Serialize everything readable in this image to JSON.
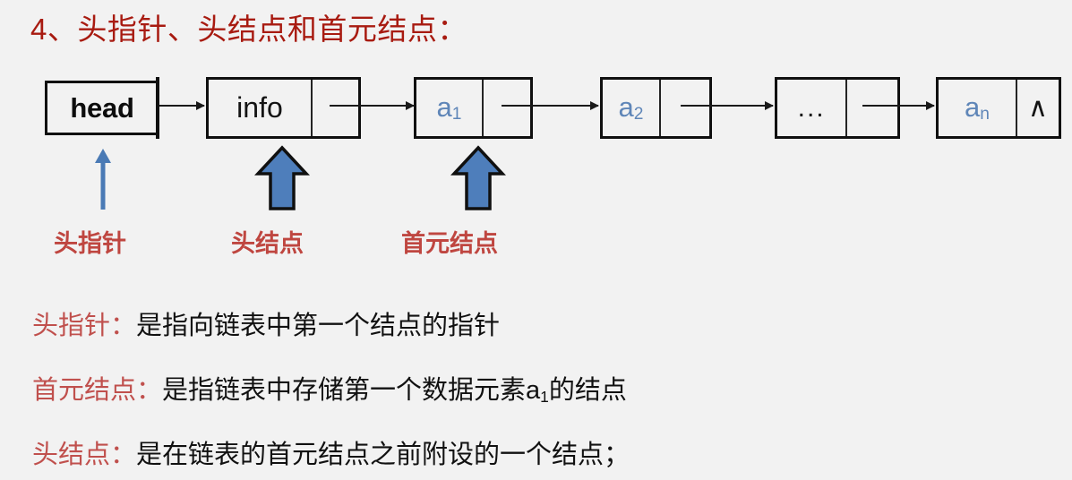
{
  "slide": {
    "title": "4、头指针、头结点和首元结点：",
    "background_color": "#f2f2f2",
    "title_color": "#a81b11"
  },
  "diagram": {
    "head_pointer": {
      "label": "head"
    },
    "nodes": [
      {
        "data": "info",
        "next": "",
        "type": "head-node"
      },
      {
        "data": "a",
        "sub": "1",
        "next": "",
        "type": "first-element-node"
      },
      {
        "data": "a",
        "sub": "2",
        "next": "",
        "type": "node"
      },
      {
        "data": "...",
        "next": "",
        "type": "ellipsis-node"
      },
      {
        "data": "a",
        "sub": "n",
        "next": "∧",
        "type": "tail-node"
      }
    ],
    "callouts": [
      {
        "label": "头指针",
        "arrow": "thin"
      },
      {
        "label": "头结点",
        "arrow": "thick"
      },
      {
        "label": "首元结点",
        "arrow": "thick"
      }
    ],
    "colors": {
      "node_border": "#101010",
      "node_text_blue": "#5f86b8",
      "arrow_blue": "#4a7ab5",
      "callout_red": "#bf4640"
    }
  },
  "definitions": [
    {
      "term": "头指针：",
      "body": "是指向链表中第一个结点的指针",
      "sub": "",
      "body_tail": ""
    },
    {
      "term": "首元结点：",
      "body": "是指链表中存储第一个数据元素a",
      "sub": "1",
      "body_tail": "的结点"
    },
    {
      "term": "头结点：",
      "body": "是在链表的首元结点之前附设的一个结点；",
      "sub": "",
      "body_tail": ""
    }
  ]
}
